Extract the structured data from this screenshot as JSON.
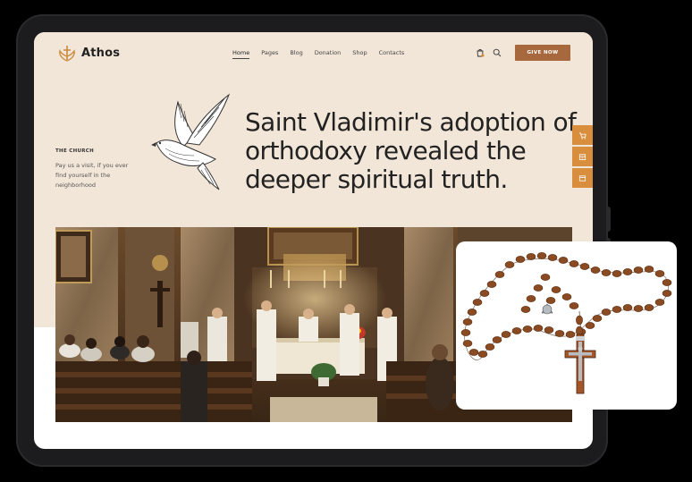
{
  "brand": {
    "name": "Athos"
  },
  "nav": {
    "items": [
      "Home",
      "Pages",
      "Blog",
      "Donation",
      "Shop",
      "Contacts"
    ],
    "active": "Home",
    "cta": "GIVE NOW"
  },
  "icons": [
    "cart-icon",
    "search-icon",
    "dove-illustration",
    "side-cart-icon",
    "side-box-icon",
    "side-window-icon"
  ],
  "hero": {
    "label": "THE CHURCH",
    "description": "Pay us a visit, if you ever find yourself in the neighborhood",
    "headline": "Saint Vladimir's adoption of orthodoxy revealed the deeper spiritual truth."
  },
  "colors": {
    "accent": "#a8683d",
    "side_tab": "#d98e3e",
    "hero_bg": "#f2e6d8"
  }
}
